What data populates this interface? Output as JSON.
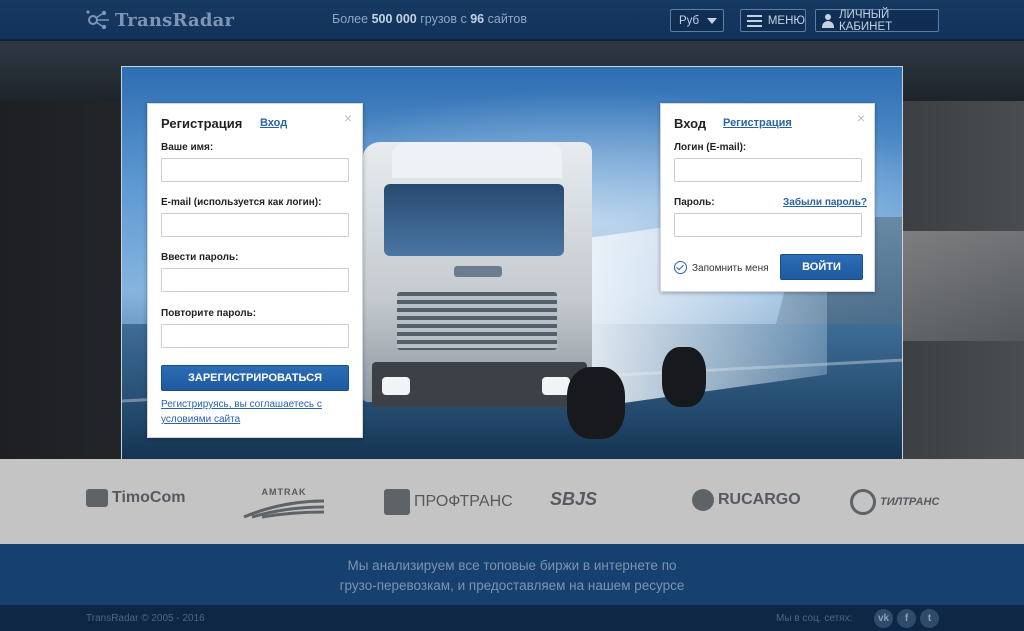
{
  "header": {
    "logo_text": "TransRadar",
    "tagline_prefix": "Более ",
    "tagline_count": "500 000",
    "tagline_mid": " грузов с ",
    "tagline_sites": "96",
    "tagline_suffix": " сайтов",
    "currency": "Руб",
    "menu_label": "МЕНЮ",
    "cabinet_label": "ЛИЧНЫЙ КАБИНЕТ"
  },
  "registration": {
    "title": "Регистрация",
    "switch_link": "Вход",
    "close": "×",
    "name_label": "Ваше имя:",
    "email_label": "E-mail (используется как логин):",
    "password_label": "Ввести пароль:",
    "repeat_label": "Повторите пароль:",
    "submit_label": "ЗАРЕГИСТРИРОВАТЬСЯ",
    "terms_line1": "Регистрируясь, вы соглашаетесь с",
    "terms_line2": "условиями сайта"
  },
  "login": {
    "title": "Вход",
    "switch_link": "Регистрация",
    "close": "×",
    "login_label": "Логин (E-mail):",
    "password_label": "Пароль:",
    "forgot_link": "Забыли пароль?",
    "remember_label": "Запомнить меня",
    "submit_label": "ВОЙТИ"
  },
  "partners": [
    "TimoCom",
    "AMTRAK",
    "ПРОФТРАНС",
    "SBJS",
    "RUCARGO",
    "ТИЛТРАНС"
  ],
  "info": {
    "line1": "Мы анализируем все топовые биржи в интернете по",
    "line2": "грузо-перевозкам, и предоставляем на нашем ресурсе"
  },
  "footer": {
    "copyright": "TransRadar © 2005 - 2016",
    "social_label": "Мы в соц. сетях:",
    "social_icons": [
      "vk-icon",
      "facebook-icon",
      "twitter-icon"
    ]
  },
  "colors": {
    "header_bg": "#173a63",
    "accent_blue": "#1e5a9f",
    "link_blue": "#2a62a8",
    "partners_bg": "#c4c4c4",
    "info_bg": "#15406f",
    "footer_bg": "#0d2745"
  }
}
